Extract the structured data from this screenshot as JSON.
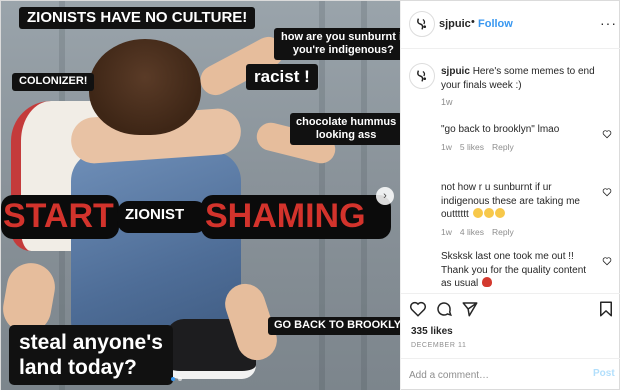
{
  "image": {
    "tags": {
      "zionists": "ZIONISTS HAVE NO CULTURE!",
      "sunburnt_line1": "how are you sunburnt if",
      "sunburnt_line2": "you're indigenous?",
      "colonizer": "COLONIZER!",
      "racist": "racist !",
      "hummus_line1": "chocolate hummus",
      "hummus_line2": "looking ass",
      "brooklyn": "GO BACK TO BROOKLYN",
      "steal_line1": "steal anyone's",
      "steal_line2": "land today?"
    },
    "banner": {
      "start": "START",
      "zionist": "ZIONIST",
      "shaming": "SHAMING"
    },
    "carousel": {
      "slide_count": 2,
      "active": 0
    },
    "next_icon": "chevron-right-icon"
  },
  "header": {
    "username": "sjpuic",
    "separator": "•",
    "follow_label": "Follow",
    "more_label": "···"
  },
  "caption": {
    "username": "sjpuic",
    "text": "Here's some memes to end your finals week :)",
    "time": "1w"
  },
  "comments": [
    {
      "text": "\"go back to brooklyn\" lmao",
      "time": "1w",
      "likes": "5 likes",
      "reply": "Reply"
    },
    {
      "text": "not how r u sunburnt if ur indigenous these are taking me outttttt",
      "time": "1w",
      "likes": "4 likes",
      "reply": "Reply"
    },
    {
      "text": "Sksksk last one took me out !! Thank you for the quality content as usual",
      "time": "",
      "likes": "",
      "reply": ""
    }
  ],
  "actions": {
    "icons": [
      "heart-icon",
      "comment-icon",
      "share-icon",
      "bookmark-icon"
    ],
    "likes": "335 likes",
    "date": "DECEMBER 11"
  },
  "add_comment": {
    "placeholder": "Add a comment…",
    "post_label": "Post"
  },
  "colors": {
    "accent": "#3897f0",
    "muted": "#8e8e8e",
    "banner_red": "#d3332c"
  }
}
